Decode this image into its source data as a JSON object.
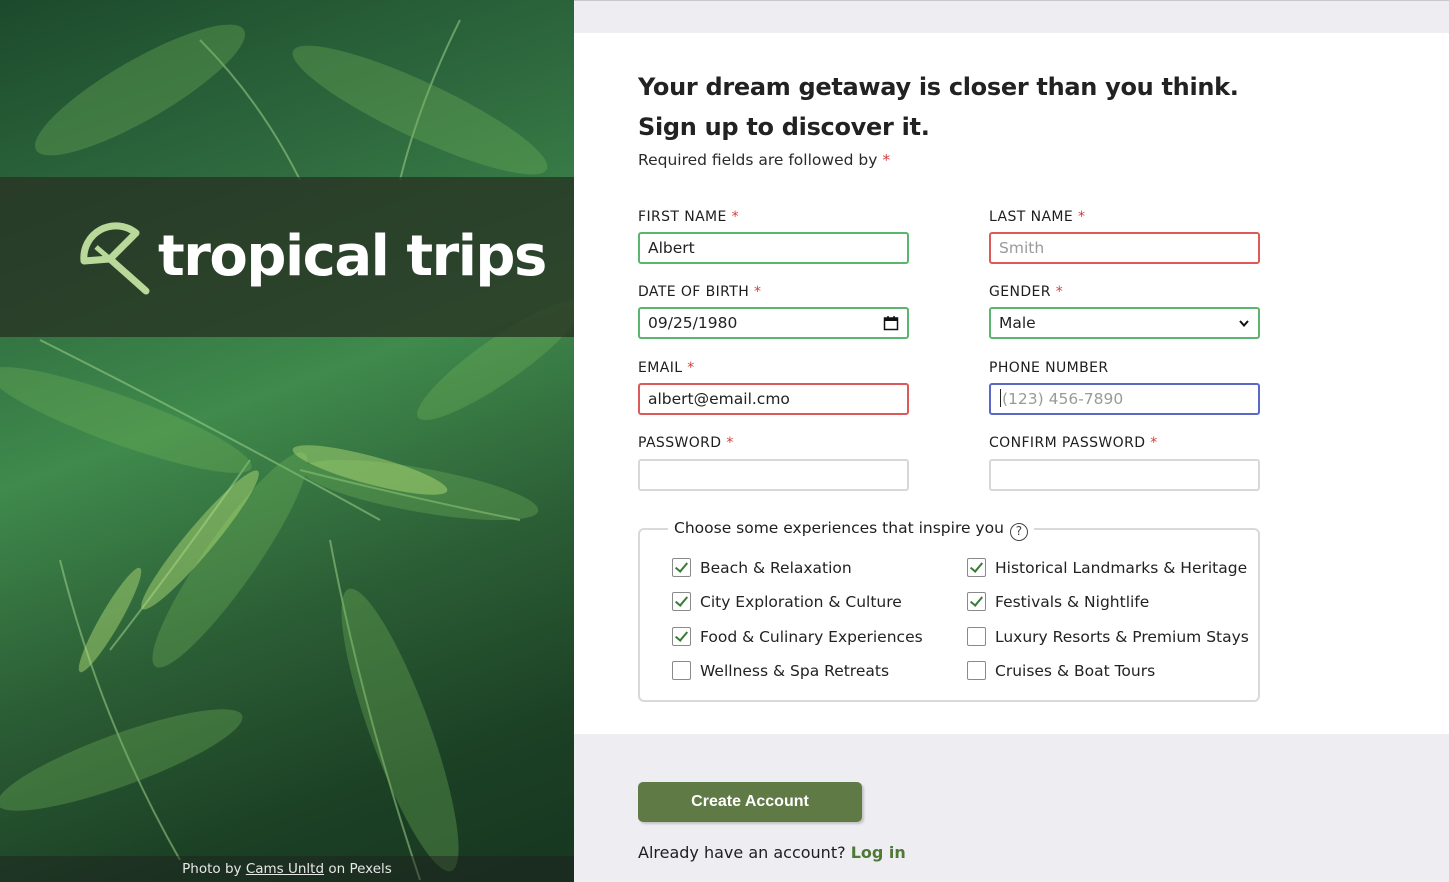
{
  "brand": {
    "name": "tropical trips",
    "credit_prefix": "Photo by",
    "credit_author": "Cams Unltd",
    "credit_suffix": "on Pexels"
  },
  "form": {
    "heading_line1": "Your dream getaway is closer than you think.",
    "heading_line2": "Sign up to discover it.",
    "required_note": "Required fields are followed by",
    "required_marker": "*",
    "first_name": {
      "label": "FIRST NAME",
      "value": "Albert",
      "state": "valid"
    },
    "last_name": {
      "label": "LAST NAME",
      "placeholder": "Smith",
      "state": "invalid"
    },
    "dob": {
      "label": "DATE OF BIRTH",
      "value": "09/25/1980",
      "state": "valid"
    },
    "gender": {
      "label": "GENDER",
      "value": "Male",
      "state": "valid"
    },
    "email": {
      "label": "EMAIL",
      "value": "albert@email.cmo",
      "state": "invalid"
    },
    "phone": {
      "label": "PHONE NUMBER",
      "placeholder": "(123) 456-7890",
      "state": "focused"
    },
    "password": {
      "label": "PASSWORD"
    },
    "confirm_password": {
      "label": "CONFIRM PASSWORD"
    },
    "experiences": {
      "legend": "Choose some experiences that inspire you",
      "help_icon": "?",
      "options": [
        {
          "label": "Beach & Relaxation",
          "checked": true
        },
        {
          "label": "Historical Landmarks & Heritage",
          "checked": true
        },
        {
          "label": "City Exploration & Culture",
          "checked": true
        },
        {
          "label": "Festivals & Nightlife",
          "checked": true
        },
        {
          "label": "Food & Culinary Experiences",
          "checked": true
        },
        {
          "label": "Luxury Resorts & Premium Stays",
          "checked": false
        },
        {
          "label": "Wellness & Spa Retreats",
          "checked": false
        },
        {
          "label": "Cruises & Boat Tours",
          "checked": false
        }
      ]
    },
    "submit_label": "Create Account",
    "login_prompt": "Already have an account?",
    "login_link": "Log in"
  },
  "colors": {
    "valid": "#5cb56f",
    "invalid": "#dd5a5a",
    "focus": "#5a68c8",
    "button": "#607a45",
    "link": "#4f7a36"
  }
}
